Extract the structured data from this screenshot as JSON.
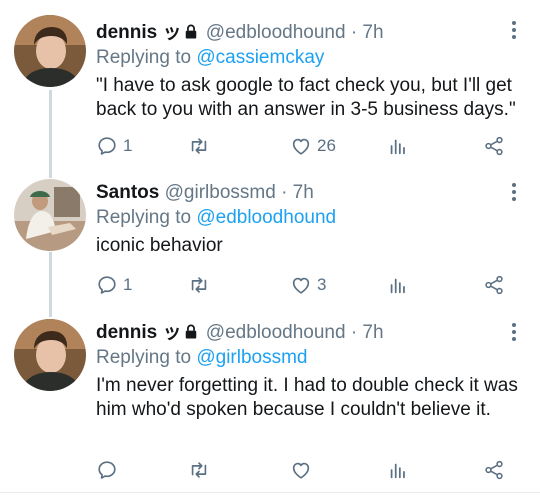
{
  "tweets": [
    {
      "name": "dennis ッ",
      "handle": "@edbloodhound",
      "time": "· 7h",
      "replying_prefix": "Replying to ",
      "replying_to": "@cassiemckay",
      "text": "\"I have to ask google to fact check you, but I'll get back to you with an answer in 3-5 business days.\"",
      "reply_count": "1",
      "retweet_count": "",
      "like_count": "26"
    },
    {
      "name": "Santos",
      "handle": "@girlbossmd",
      "time": "· 7h",
      "replying_prefix": "Replying to ",
      "replying_to": "@edbloodhound",
      "text": "iconic behavior",
      "reply_count": "1",
      "retweet_count": "",
      "like_count": "3"
    },
    {
      "name": "dennis ッ",
      "handle": "@edbloodhound",
      "time": "· 7h",
      "replying_prefix": "Replying to ",
      "replying_to": "@girlbossmd",
      "text": "I'm never forgetting it. I had to double check it was him who'd spoken because I couldn't believe it.",
      "reply_count": "",
      "retweet_count": "",
      "like_count": ""
    }
  ],
  "colors": {
    "link": "#1da1f2",
    "secondary": "#657786",
    "icon": "#5b7083",
    "thread_line": "#cfd9de"
  }
}
